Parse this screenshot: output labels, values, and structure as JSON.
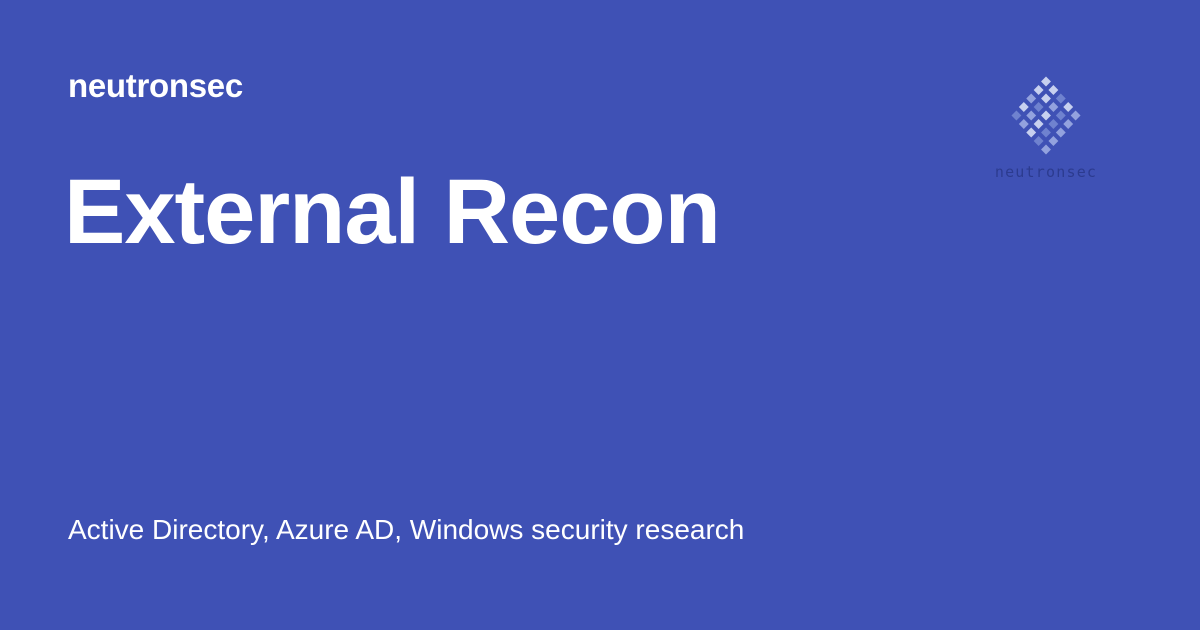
{
  "header": {
    "site_name": "neutronsec"
  },
  "hero": {
    "title": "External Recon"
  },
  "footer": {
    "description": "Active Directory, Azure AD, Windows security research"
  },
  "logo": {
    "icon": "diamond-grid-logo-icon",
    "text": "neutronsec",
    "colors": {
      "light": "#c7d0ef",
      "mid": "#93a2de",
      "dark": "#6f82cf",
      "text": "#2c3b8f"
    }
  },
  "colors": {
    "background": "#3f51b5",
    "text": "#ffffff"
  }
}
